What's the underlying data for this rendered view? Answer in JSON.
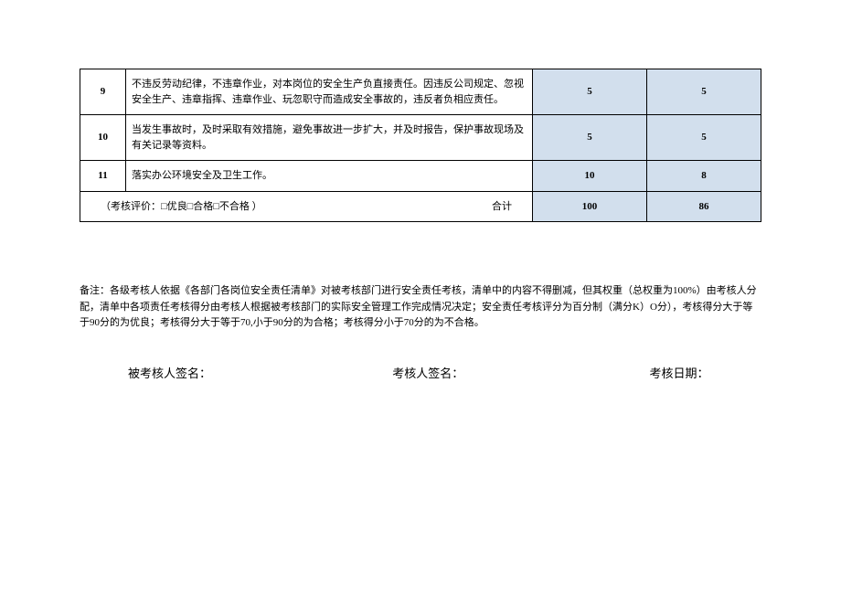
{
  "table": {
    "rows": [
      {
        "num": "9",
        "desc": "不违反劳动纪律，不违章作业，对本岗位的安全生产负直接责任。因违反公司规定、忽视安全生产、违章指挥、违章作业、玩忽职守而造成安全事故的，违反者负相应责任。",
        "a": "5",
        "b": "5"
      },
      {
        "num": "10",
        "desc": "当发生事故时，及时采取有效措施，避免事故进一步扩大，并及时报告，保护事故现场及有关记录等资料。",
        "a": "5",
        "b": "5"
      },
      {
        "num": "11",
        "desc": "落实办公环境安全及卫生工作。",
        "a": "10",
        "b": "8"
      }
    ],
    "summary": {
      "label": "（考核评价：□优良□合格□不合格                      ）",
      "heji": "合计",
      "a": "100",
      "b": "86"
    }
  },
  "note": "备注：各级考核人依据《各部门各岗位安全责任清单》对被考核部门进行安全责任考核，清单中的内容不得删减，但其权重（总权重为100%）由考核人分配，清单中各项责任考核得分由考核人根据被考核部门的实际安全管理工作完成情况决定；安全责任考核评分为百分制（满分K）O分），考核得分大于等于90分的为优良；考核得分大于等于70,小于90分的为合格；考核得分小于70分的为不合格。",
  "signatures": {
    "s1": "被考核人签名：",
    "s2": "考核人签名：",
    "s3": "考核日期："
  }
}
